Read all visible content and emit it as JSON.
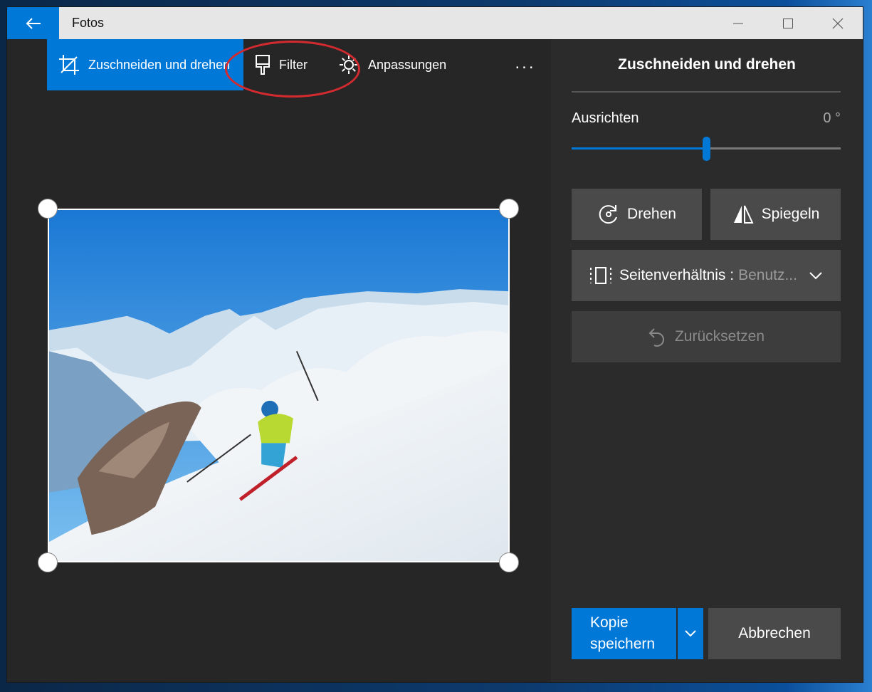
{
  "titlebar": {
    "app_title": "Fotos",
    "back_icon": "arrow-left-icon",
    "controls": [
      "minimize-icon",
      "maximize-icon",
      "close-icon"
    ]
  },
  "toolbar": {
    "tabs": [
      {
        "label": "Zuschneiden und drehen",
        "icon": "crop-icon",
        "active": true
      },
      {
        "label": "Filter",
        "icon": "filter-brush-icon",
        "active": false
      },
      {
        "label": "Anpassungen",
        "icon": "brightness-icon",
        "active": false
      }
    ],
    "more_label": "..."
  },
  "panel": {
    "title": "Zuschneiden und drehen",
    "straighten_label": "Ausrichten",
    "straighten_value": "0 °",
    "straighten_fraction": 0.5,
    "rotate_label": "Drehen",
    "flip_label": "Spiegeln",
    "aspect_label": "Seitenverhältnis :",
    "aspect_value": "Benutz...",
    "reset_label": "Zurücksetzen",
    "save_label_line1": "Kopie",
    "save_label_line2": "speichern",
    "cancel_label": "Abbrechen"
  },
  "colors": {
    "accent": "#0078d7",
    "annotation": "#d32a2f",
    "panel_bg": "#2b2b2b",
    "button_bg": "#4a4a4a"
  }
}
